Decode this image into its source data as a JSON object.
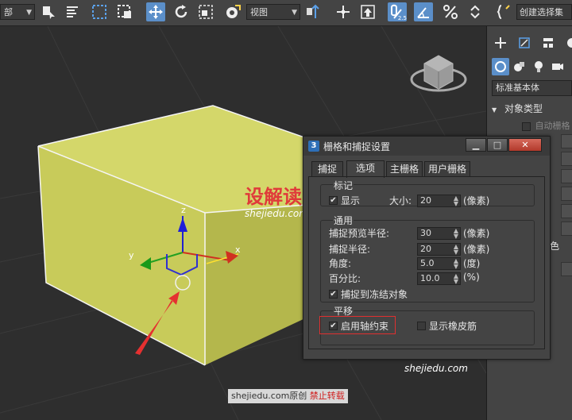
{
  "toolbar": {
    "left_dropdown": "部",
    "view_dropdown": "视图",
    "snap_label": "2.5",
    "create_selection": "创建选择集"
  },
  "dialog": {
    "title": "栅格和捕捉设置",
    "app_icon": "3",
    "tabs": [
      {
        "label": "捕捉",
        "active": false
      },
      {
        "label": "选项",
        "active": true
      },
      {
        "label": "主栅格",
        "active": false
      },
      {
        "label": "用户栅格",
        "active": false
      }
    ],
    "marker": {
      "label": "标记",
      "display_label": "显示",
      "display_checked": true,
      "size_label": "大小:",
      "size_value": "20",
      "size_unit": "(像素)"
    },
    "general": {
      "label": "通用",
      "preview_radius_label": "捕捉预览半径:",
      "preview_radius_value": "30",
      "preview_radius_unit": "(像素)",
      "snap_radius_label": "捕捉半径:",
      "snap_radius_value": "20",
      "snap_radius_unit": "(像素)",
      "angle_label": "角度:",
      "angle_value": "5.0",
      "angle_unit": "(度)",
      "percent_label": "百分比:",
      "percent_value": "10.0",
      "percent_unit": "(%)",
      "snap_frozen_label": "捕捉到冻结对象",
      "snap_frozen_checked": true
    },
    "translation": {
      "label": "平移",
      "axis_constraint_label": "启用轴约束",
      "axis_constraint_checked": true,
      "rubber_band_label": "显示橡皮筋",
      "rubber_band_checked": false
    }
  },
  "command_panel": {
    "category_dropdown": "标准基本体",
    "rollout_title": "对象类型",
    "autogrid_label": "自动栅格",
    "partial_label": "色"
  },
  "viewport": {
    "box_color": "#c8cb5a",
    "gizmo_axes": {
      "x": "x",
      "y": "y",
      "z": "z"
    }
  },
  "watermark": {
    "logo": "设解读",
    "url": "shejiedu.com",
    "footer_site": "shejiedu.com",
    "footer_original": "原创",
    "footer_notice": "禁止转载"
  },
  "colors": {
    "accent": "#5b8fc9",
    "panel": "#444444",
    "highlight_box": "#e03030",
    "logo_red": "#e03a3a"
  }
}
